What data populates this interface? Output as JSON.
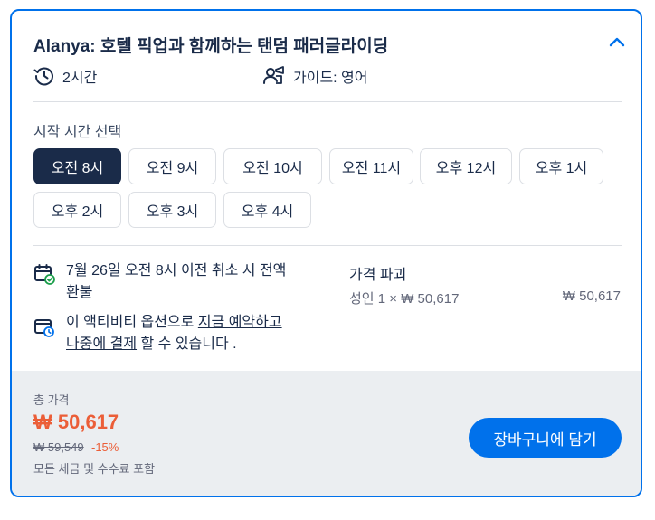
{
  "option": {
    "title": "Alanya: 호텔 픽업과 함께하는 탠덤 패러글라이딩",
    "duration": "2시간",
    "guide": "가이드: 영어"
  },
  "time_selection": {
    "label": "시작 시간 선택",
    "slots": [
      {
        "label": "오전 8시",
        "selected": true
      },
      {
        "label": "오전 9시",
        "selected": false
      },
      {
        "label": "오전 10시",
        "selected": false
      },
      {
        "label": "오전 11시",
        "selected": false
      },
      {
        "label": "오후 12시",
        "selected": false
      },
      {
        "label": "오후 1시",
        "selected": false
      },
      {
        "label": "오후 2시",
        "selected": false
      },
      {
        "label": "오후 3시",
        "selected": false
      },
      {
        "label": "오후 4시",
        "selected": false
      }
    ]
  },
  "policies": {
    "cancellation_line1": "7월 26일 오전 8시 이전 취소 시 전액",
    "cancellation_line2": "환불",
    "reserve_prefix": "이 액티비티 옵션으로 ",
    "reserve_link_1": "지금 예약하고",
    "reserve_link_2": "나중에 결제",
    "reserve_suffix": " 할 수 있습니다 ."
  },
  "price_breakdown": {
    "title": "가격 파괴",
    "line_label": "성인 1 × ₩ 50,617",
    "line_total": "₩ 50,617"
  },
  "footer": {
    "total_label": "총 가격",
    "total_price": "₩ 50,617",
    "original_price": "₩ 59,549",
    "discount": "-15%",
    "tax_note": "모든 세금 및 수수료 포함",
    "cart_button": "장바구니에 담기"
  },
  "colors": {
    "accent_blue": "#0071eb",
    "navy": "#1a2b49",
    "price_orange": "#eb5e38",
    "footer_bg": "#ebeef1"
  },
  "icons": {
    "collapse": "chevron-up-icon",
    "duration": "clock-history-icon",
    "guide": "guide-people-icon",
    "cancellation": "calendar-check-icon",
    "reserve": "wallet-clock-icon"
  }
}
